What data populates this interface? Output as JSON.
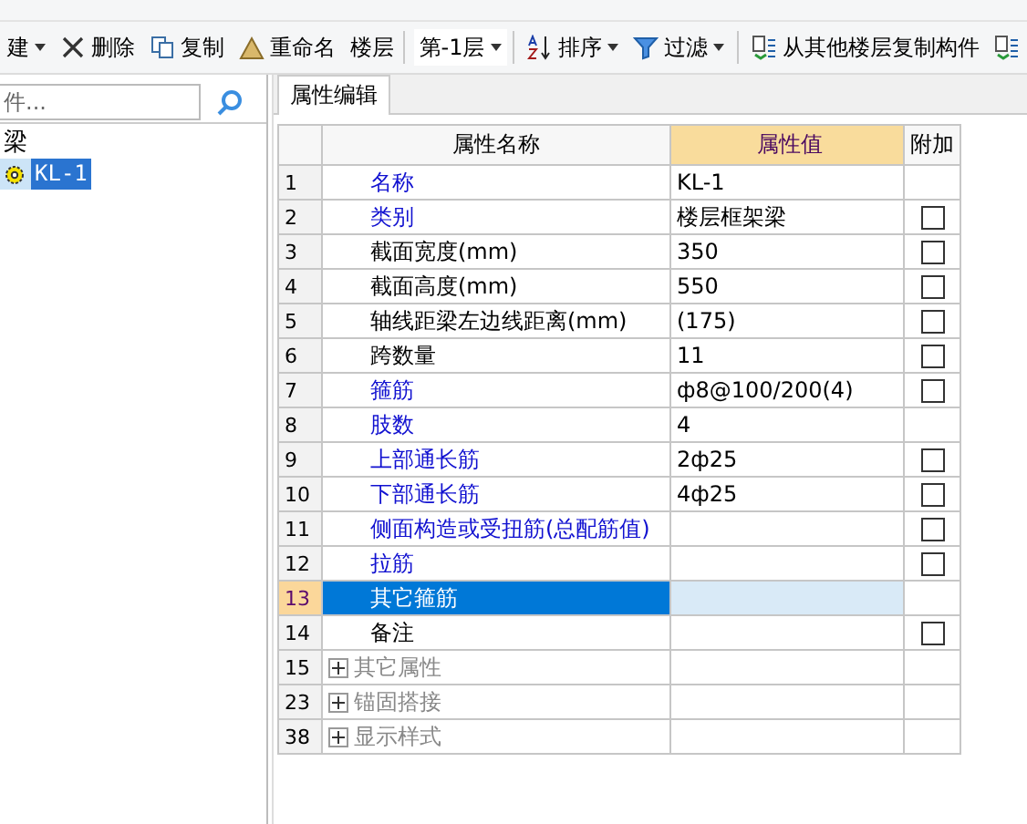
{
  "toolbar": {
    "items": [
      {
        "kind": "menu",
        "label": "建"
      },
      {
        "kind": "button",
        "label": "删除"
      },
      {
        "kind": "button",
        "label": "复制"
      },
      {
        "kind": "button",
        "label": "重命名"
      },
      {
        "kind": "label",
        "label": "楼层"
      },
      {
        "kind": "select",
        "value": "第-1层"
      },
      {
        "kind": "menu",
        "label": "排序"
      },
      {
        "kind": "menu",
        "label": "过滤"
      },
      {
        "kind": "button",
        "label": "从其他楼层复制构件"
      },
      {
        "kind": "iconbutton"
      }
    ]
  },
  "sidebar": {
    "search": {
      "placeholder": "件..."
    },
    "tree": [
      {
        "label": "梁",
        "expanded": true,
        "children": [
          {
            "label": "KL-1",
            "selected": true
          }
        ]
      }
    ]
  },
  "tabs": [
    {
      "label": "属性编辑",
      "selected": true
    }
  ],
  "table": {
    "columns": [
      "属性名称",
      "属性值",
      "附加"
    ],
    "rows": [
      {
        "index": "1",
        "name": "名称",
        "kind": "public",
        "value": "KL-1",
        "selected": false
      },
      {
        "index": "2",
        "name": "类别",
        "kind": "public",
        "value": "楼层框架梁",
        "checked": false,
        "selected": false
      },
      {
        "index": "3",
        "name": "截面宽度(mm)",
        "kind": "private",
        "value": "350",
        "checked": false,
        "selected": false
      },
      {
        "index": "4",
        "name": "截面高度(mm)",
        "kind": "private",
        "value": "550",
        "checked": false,
        "selected": false
      },
      {
        "index": "5",
        "name": "轴线距梁左边线距离(mm)",
        "kind": "private",
        "value": "(175)",
        "checked": false,
        "selected": false
      },
      {
        "index": "6",
        "name": "跨数量",
        "kind": "private",
        "value": "11",
        "checked": false,
        "selected": false
      },
      {
        "index": "7",
        "name": "箍筋",
        "kind": "public",
        "value": "ф8@100/200(4)",
        "checked": false,
        "selected": false
      },
      {
        "index": "8",
        "name": "肢数",
        "kind": "public",
        "value": "4",
        "selected": false
      },
      {
        "index": "9",
        "name": "上部通长筋",
        "kind": "public",
        "value": "2ф25",
        "checked": false,
        "selected": false
      },
      {
        "index": "10",
        "name": "下部通长筋",
        "kind": "public",
        "value": "4ф25",
        "checked": false,
        "selected": false
      },
      {
        "index": "11",
        "name": "侧面构造或受扭筋(总配筋值)",
        "kind": "public",
        "checked": false,
        "selected": false
      },
      {
        "index": "12",
        "name": "拉筋",
        "kind": "public",
        "checked": false,
        "selected": false
      },
      {
        "index": "13",
        "name": "其它箍筋",
        "kind": "public",
        "selected": true
      },
      {
        "index": "14",
        "name": "备注",
        "kind": "private",
        "checked": false,
        "selected": false
      },
      {
        "index": "15",
        "name": "其它属性",
        "kind": "group",
        "expanded": false,
        "selected": false
      },
      {
        "index": "23",
        "name": "锚固搭接",
        "kind": "group",
        "expanded": false,
        "selected": false
      },
      {
        "index": "38",
        "name": "显示样式",
        "kind": "group",
        "expanded": false,
        "selected": false
      }
    ]
  }
}
